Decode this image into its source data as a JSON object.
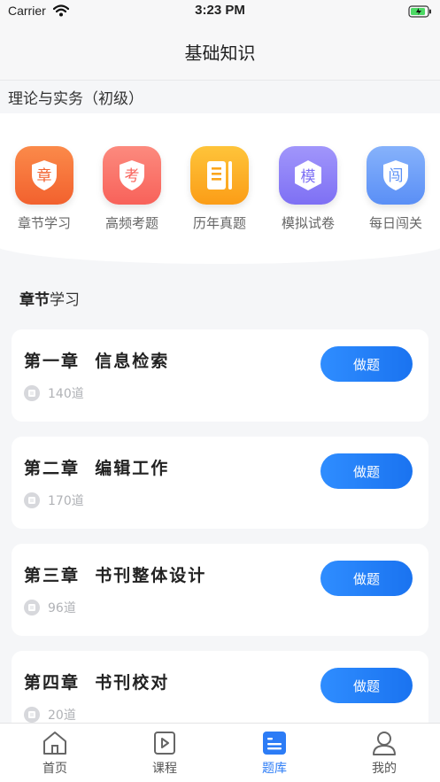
{
  "status_bar": {
    "carrier": "Carrier",
    "time": "3:23 PM"
  },
  "nav": {
    "title": "基础知识"
  },
  "subject": {
    "title": "理论与实务（初级）"
  },
  "categories": [
    {
      "label": "章节学习",
      "glyph": "章",
      "icon": "chapter-shield-icon",
      "color": "#f7763d"
    },
    {
      "label": "高频考题",
      "glyph": "考",
      "icon": "exam-shield-icon",
      "color": "#fb7669"
    },
    {
      "label": "历年真题",
      "glyph": "",
      "icon": "book-icon",
      "color": "#fdb226"
    },
    {
      "label": "模拟试卷",
      "glyph": "模",
      "icon": "mock-hexagon-icon",
      "color": "#9185f8"
    },
    {
      "label": "每日闯关",
      "glyph": "闯",
      "icon": "challenge-shield-icon",
      "color": "#6b9ef9"
    }
  ],
  "section": {
    "title_bold": "章节",
    "title_rest": "学习"
  },
  "chapters": [
    {
      "name": "第一章  信息检索",
      "count": "140道",
      "button": "做题"
    },
    {
      "name": "第二章  编辑工作",
      "count": "170道",
      "button": "做题"
    },
    {
      "name": "第三章  书刊整体设计",
      "count": "96道",
      "button": "做题"
    },
    {
      "name": "第四章  书刊校对",
      "count": "20道",
      "button": "做题"
    }
  ],
  "tabs": [
    {
      "label": "首页",
      "icon": "home-icon",
      "active": false
    },
    {
      "label": "课程",
      "icon": "course-play-icon",
      "active": false
    },
    {
      "label": "题库",
      "icon": "question-bank-icon",
      "active": true
    },
    {
      "label": "我的",
      "icon": "profile-icon",
      "active": false
    }
  ],
  "colors": {
    "accent": "#2c7cf6",
    "button": "#2180fb",
    "inactive_tab": "#555555"
  }
}
